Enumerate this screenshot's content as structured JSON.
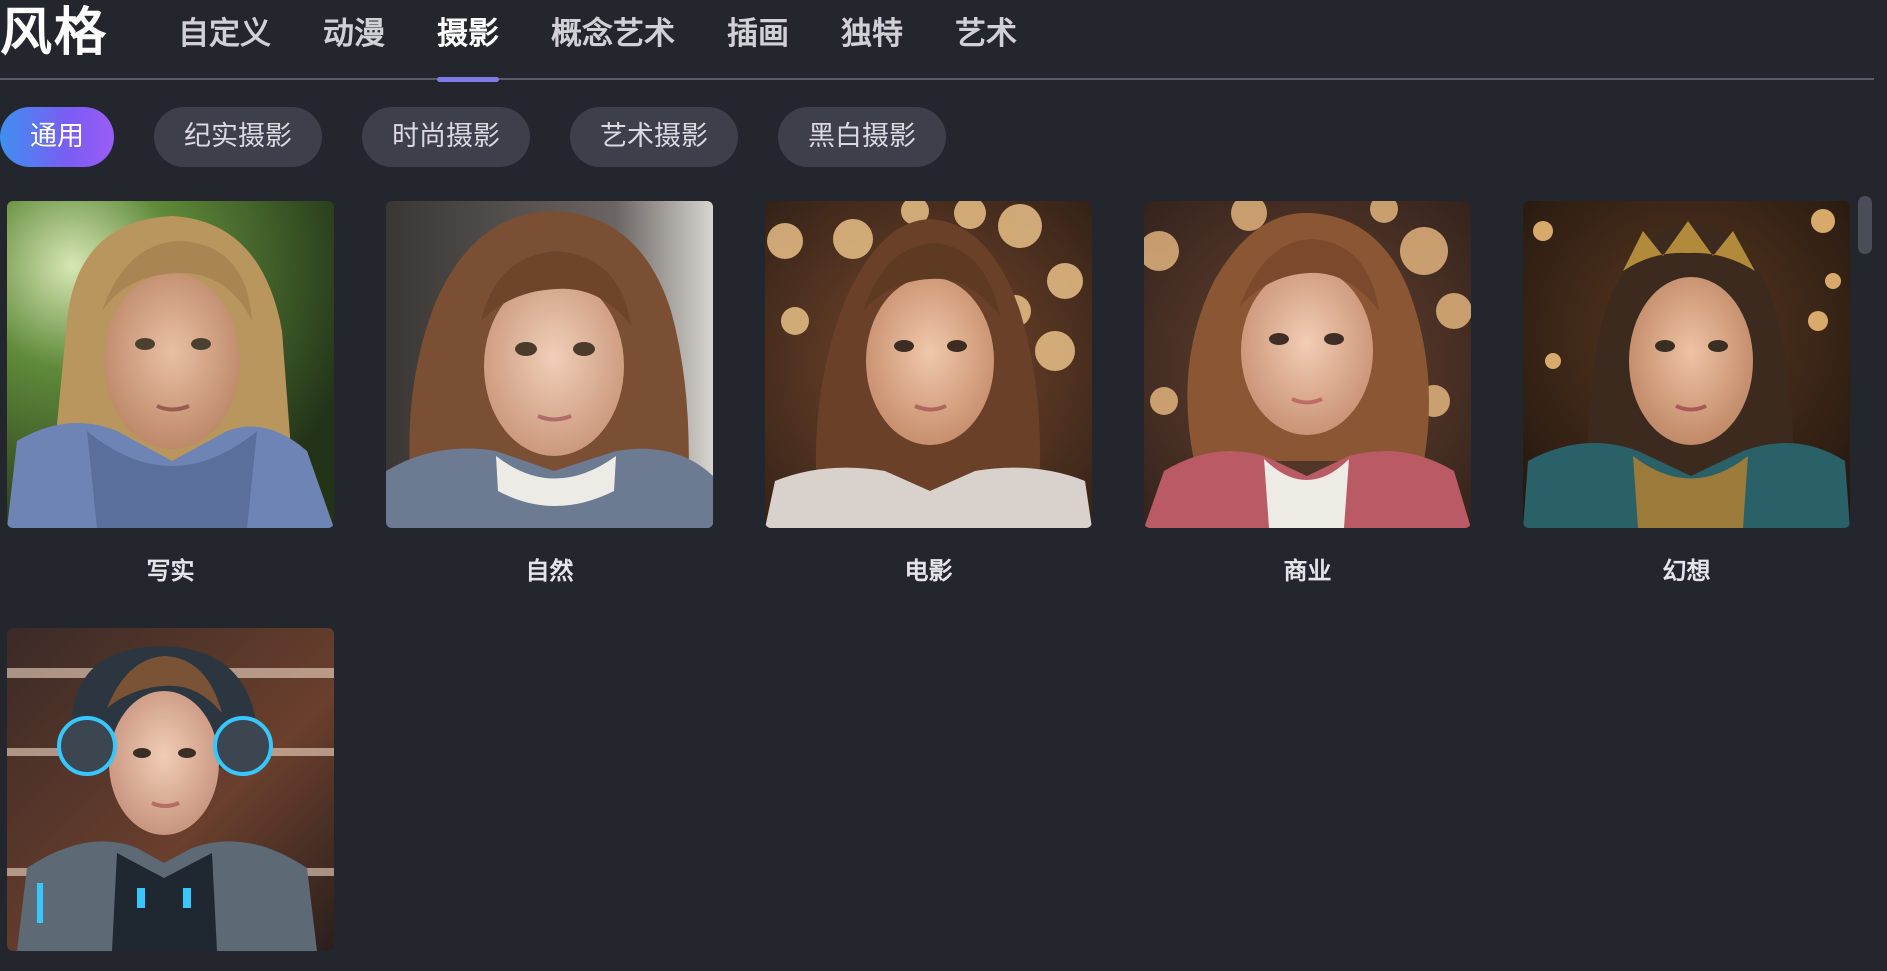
{
  "header": {
    "title": "风格",
    "tabs": [
      {
        "label": "自定义",
        "active": false
      },
      {
        "label": "动漫",
        "active": false
      },
      {
        "label": "摄影",
        "active": true
      },
      {
        "label": "概念艺术",
        "active": false
      },
      {
        "label": "插画",
        "active": false
      },
      {
        "label": "独特",
        "active": false
      },
      {
        "label": "艺术",
        "active": false
      }
    ]
  },
  "chips": [
    {
      "label": "通用",
      "active": true
    },
    {
      "label": "纪实摄影",
      "active": false
    },
    {
      "label": "时尚摄影",
      "active": false
    },
    {
      "label": "艺术摄影",
      "active": false
    },
    {
      "label": "黑白摄影",
      "active": false
    }
  ],
  "styles": [
    {
      "label": "写实",
      "image": "girl-portrait-blue-hoodie-sunlit-park"
    },
    {
      "label": "自然",
      "image": "girl-portrait-wavy-hair-blue-sweater"
    },
    {
      "label": "电影",
      "image": "girl-portrait-braided-hair-bokeh-lights"
    },
    {
      "label": "商业",
      "image": "girl-portrait-pink-hoodie-bokeh"
    },
    {
      "label": "幻想",
      "image": "girl-portrait-crown-braids-fantasy"
    },
    {
      "label": "",
      "image": "girl-portrait-cyber-armor-headphones"
    }
  ],
  "colors": {
    "background": "#23262d",
    "chip": "#3d404b",
    "accent_start": "#3f8ff0",
    "accent_end": "#9a5cf6",
    "tab_underline": "#7f7ce8"
  }
}
